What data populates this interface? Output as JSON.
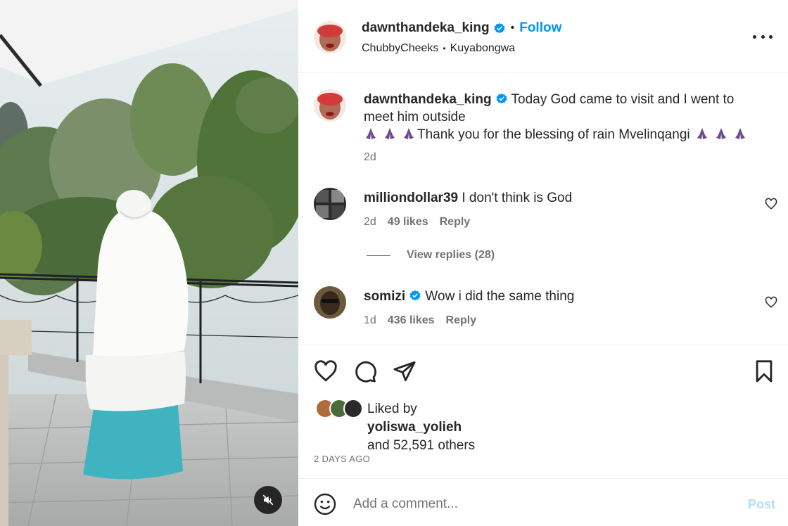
{
  "post": {
    "author": {
      "username": "dawnthandeka_king",
      "verified": true,
      "follow_label": "Follow",
      "audio_artist": "ChubbyCheeks",
      "audio_title": "Kuyabongwa"
    },
    "caption": {
      "username": "dawnthandeka_king",
      "text_line1": "Today God came to visit and I went to meet him outside",
      "text_line2": "Thank you for the blessing of rain Mvelinqangi",
      "emoji": "pray-dark-skin",
      "time": "2d"
    },
    "comments": [
      {
        "username": "milliondollar39",
        "verified": false,
        "text": "I don't think is God",
        "time": "2d",
        "likes": "49 likes",
        "reply_label": "Reply",
        "view_replies": "View replies (28)"
      },
      {
        "username": "somizi",
        "verified": true,
        "text": "Wow i did the same thing",
        "time": "1d",
        "likes": "436 likes",
        "reply_label": "Reply"
      }
    ],
    "likes": {
      "liked_by_label": "Liked by",
      "liked_by_user": "yoliswa_yolieh",
      "others": "and 52,591 others"
    },
    "time_ago": "2 DAYS AGO",
    "composer": {
      "placeholder": "Add a comment...",
      "post_label": "Post"
    },
    "colors": {
      "accent": "#0095f6",
      "verified": "#0095f6",
      "post_disabled": "#b2dffc",
      "muted": "#737373"
    },
    "icons": [
      "verified-badge-icon",
      "more-options-icon",
      "heart-icon",
      "comment-icon",
      "share-icon",
      "bookmark-icon",
      "emoji-icon",
      "muted-audio-icon",
      "pray-emoji"
    ]
  }
}
